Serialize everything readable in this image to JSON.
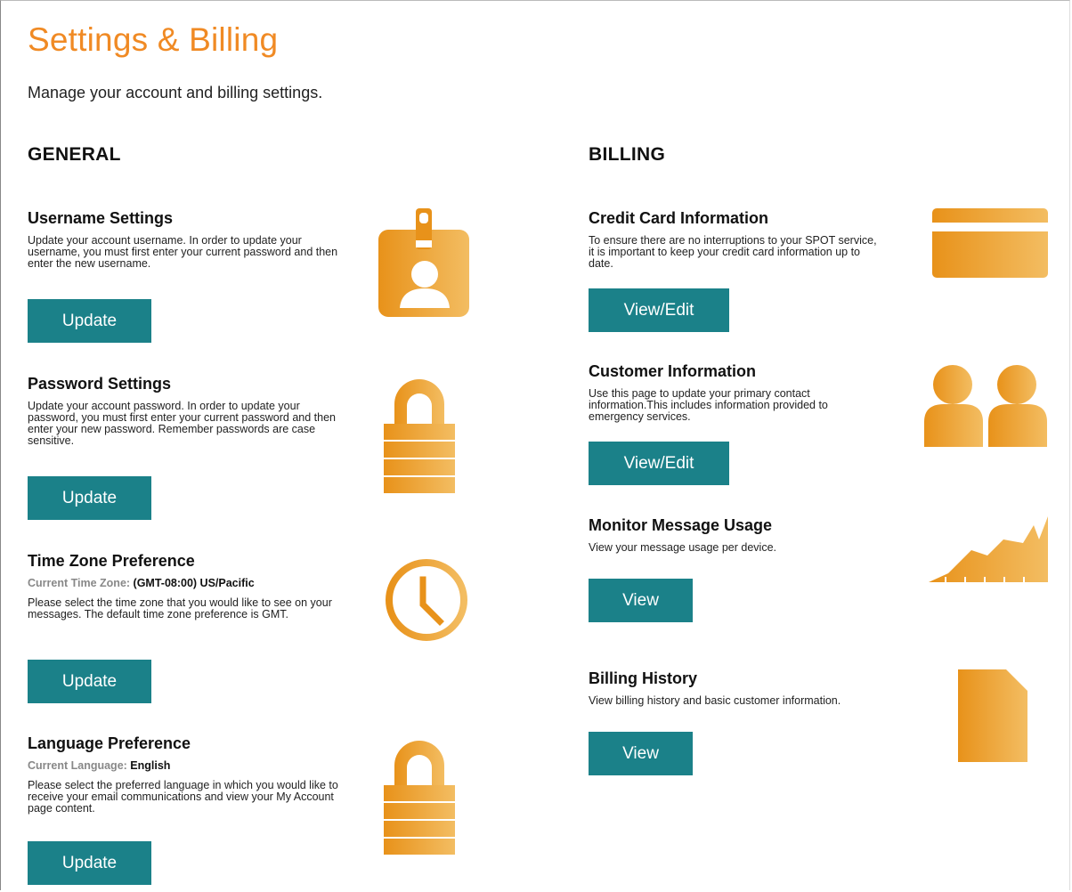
{
  "header": {
    "title": "Settings & Billing",
    "subtitle": "Manage your account and billing settings."
  },
  "general": {
    "heading": "GENERAL",
    "username": {
      "title": "Username Settings",
      "description": "Update your account username. In order to update your username, you must first enter your current password and then enter the new username.",
      "button": "Update",
      "icon": "id-badge-icon"
    },
    "password": {
      "title": "Password Settings",
      "description": "Update your account password. In order to update your password, you must first enter your current password and then enter your new password. Remember passwords are case sensitive.",
      "button": "Update",
      "icon": "lock-icon"
    },
    "timezone": {
      "title": "Time Zone Preference",
      "current_label": "Current Time Zone:",
      "current_value": "(GMT-08:00) US/Pacific",
      "description": "Please select the time zone that you would like to see on your messages. The default time zone preference is GMT.",
      "button": "Update",
      "icon": "clock-icon"
    },
    "language": {
      "title": "Language Preference",
      "current_label": "Current Language:",
      "current_value": "English",
      "description": "Please select the preferred language in which you would like to receive your email communications and view your My Account page content.",
      "button": "Update",
      "icon": "lock-icon"
    }
  },
  "billing": {
    "heading": "BILLING",
    "credit_card": {
      "title": "Credit Card Information",
      "description": "To ensure there are no interruptions to your SPOT service, it is important to keep your credit card information up to date.",
      "button": "View/Edit",
      "icon": "credit-card-icon"
    },
    "customer": {
      "title": "Customer Information",
      "description": "Use this page to update your primary contact information.This includes information provided to emergency services.",
      "button": "View/Edit",
      "icon": "people-icon"
    },
    "usage": {
      "title": "Monitor Message Usage",
      "description": "View your message usage per device.",
      "button": "View",
      "icon": "usage-chart-icon"
    },
    "history": {
      "title": "Billing History",
      "description": "View billing history and basic customer information.",
      "button": "View",
      "icon": "document-icon"
    }
  },
  "colors": {
    "accent_orange": "#f08a24",
    "icon_orange_dark": "#e8921a",
    "icon_orange_light": "#f3bd62",
    "button_teal": "#1b8189"
  }
}
